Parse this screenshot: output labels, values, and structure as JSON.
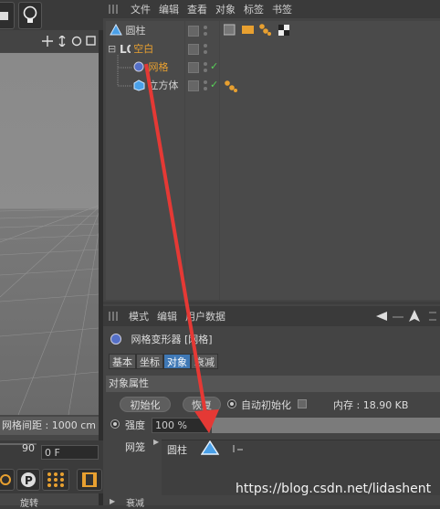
{
  "colors": {
    "accent_orange": "#e8a030",
    "selection_blue": "#3f78b5",
    "arrow_red": "#e53935",
    "check_green": "#58d058"
  },
  "viewport": {
    "grid_distance": "网格间距 : 1000 cm",
    "frame_value": "90",
    "frame_field": "0 F",
    "bottom_label": "旋转",
    "icons": [
      "bulb-icon",
      "move-icon",
      "zoom-icon",
      "rotate-icon",
      "maximize-icon"
    ]
  },
  "object_manager": {
    "menu": [
      "文件",
      "编辑",
      "查看",
      "对象",
      "标签",
      "书签"
    ],
    "objects": [
      {
        "name": "圆柱",
        "icon": "deformer-cone-icon",
        "color": "#d0d0d0"
      },
      {
        "name": "空白",
        "icon": "null-icon",
        "color": "#e8a030"
      },
      {
        "name": "网格",
        "icon": "mesh-deformer-icon",
        "color": "#e8a030"
      },
      {
        "name": "立方体",
        "icon": "cube-icon",
        "color": "#d0d0d0"
      }
    ]
  },
  "attribute_manager": {
    "menu": [
      "模式",
      "编辑",
      "用户数据"
    ],
    "title": "网格变形器 [网格]",
    "tabs": [
      "基本",
      "坐标",
      "对象",
      "衰减"
    ],
    "active_tab": "对象",
    "section": "对象属性",
    "init_button": "初始化",
    "restore_button": "恢复",
    "auto_init_label": "自动初始化",
    "memory": "内存 : 18.90 KB",
    "strength_label": "强度",
    "strength_value": "100 %",
    "strength_fraction": 1.0,
    "mesh_label": "网笼",
    "mesh_object": "圆柱",
    "collapsed_label": "衰减"
  },
  "watermark": "https://blog.csdn.net/lidashent"
}
